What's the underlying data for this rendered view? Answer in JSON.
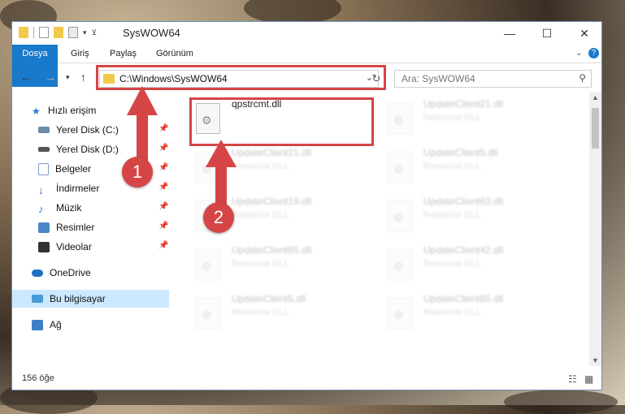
{
  "window": {
    "title": "SysWOW64"
  },
  "ribbon": {
    "tabs": [
      "Dosya",
      "Giriş",
      "Paylaş",
      "Görünüm"
    ]
  },
  "address": {
    "path": "C:\\Windows\\SysWOW64"
  },
  "search": {
    "placeholder": "Ara: SysWOW64"
  },
  "sidebar": {
    "items": [
      {
        "label": "Hızlı erişim",
        "icon": "star-icon"
      },
      {
        "label": "Yerel Disk (C:)",
        "icon": "drive-icon"
      },
      {
        "label": "Yerel Disk (D:)",
        "icon": "drive-icon"
      },
      {
        "label": "Belgeler",
        "icon": "document-icon"
      },
      {
        "label": "İndirmeler",
        "icon": "download-icon"
      },
      {
        "label": "Müzik",
        "icon": "music-icon"
      },
      {
        "label": "Resimler",
        "icon": "pictures-icon"
      },
      {
        "label": "Videolar",
        "icon": "video-icon"
      },
      {
        "label": "OneDrive",
        "icon": "cloud-icon"
      },
      {
        "label": "Bu bilgisayar",
        "icon": "computer-icon"
      },
      {
        "label": "Ağ",
        "icon": "network-icon"
      }
    ]
  },
  "files": [
    {
      "name": "qpstrcmt.dll",
      "type": ""
    },
    {
      "name": "UpdateClient21.dll",
      "type": "Resource DLL"
    },
    {
      "name": "UpdateClient21.dll",
      "type": "Resource DLL"
    },
    {
      "name": "UpdateClient5.dll",
      "type": "Resource DLL"
    },
    {
      "name": "UpdateClient19.dll",
      "type": "Resource DLL"
    },
    {
      "name": "UpdateClient63.dll",
      "type": "Resource DLL"
    },
    {
      "name": "UpdateClient65.dll",
      "type": "Resource DLL"
    },
    {
      "name": "UpdateClient42.dll",
      "type": "Resource DLL"
    },
    {
      "name": "UpdateClient5.dll",
      "type": "Resource DLL"
    },
    {
      "name": "UpdateClient65.dll",
      "type": "Resource DLL"
    }
  ],
  "status": {
    "count": "156 öğe"
  },
  "callouts": [
    "1",
    "2"
  ],
  "colors": {
    "accent": "#1979ca",
    "highlight": "#d64545",
    "selected": "#cce8ff"
  }
}
